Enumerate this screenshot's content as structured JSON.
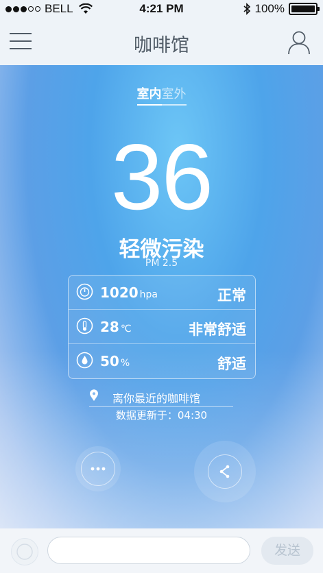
{
  "status_bar": {
    "carrier": "BELL",
    "time": "4:21 PM",
    "battery": "100%"
  },
  "navbar": {
    "title": "咖啡馆"
  },
  "tabs": [
    {
      "label": "室内",
      "active": true
    },
    {
      "label": "室外",
      "active": false
    }
  ],
  "air": {
    "value": "36",
    "level": "轻微污染",
    "metric": "PM 2.5"
  },
  "conditions": [
    {
      "icon": "pressure-gauge-icon",
      "value": "1020",
      "unit": "hpa",
      "status": "正常"
    },
    {
      "icon": "thermometer-icon",
      "value": "28",
      "unit": "℃",
      "status": "非常舒适"
    },
    {
      "icon": "humidity-drop-icon",
      "value": "50",
      "unit": "%",
      "status": "舒适"
    }
  ],
  "location": {
    "text": "离你最近的咖啡馆"
  },
  "updated": {
    "text": "数据更新于：04:30"
  },
  "actions": {
    "more_icon": "more-dots-icon",
    "share_icon": "share-icon"
  },
  "composer": {
    "input_value": "",
    "send_label": "发送"
  },
  "colors": {
    "accent": "#4ea4ea",
    "background": "#eef3f8",
    "send_text": "#b8c4d0"
  }
}
